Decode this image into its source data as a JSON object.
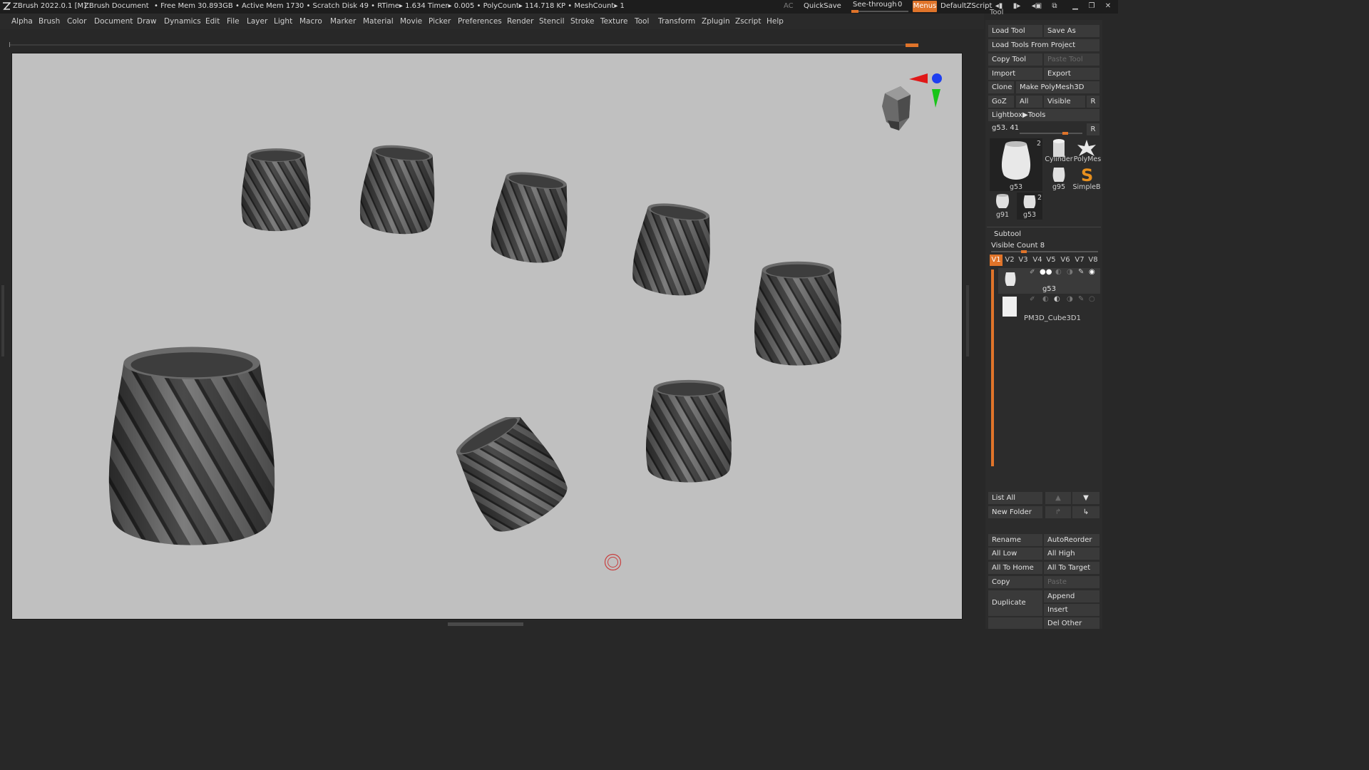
{
  "titlebar": {
    "app": "ZBrush 2022.0.1 [M]",
    "document": "ZBrush Document",
    "stats": "• Free Mem 30.893GB • Active Mem 1730 • Scratch Disk 49 •  RTime▸ 1.634 Timer▸ 0.005 • PolyCount▸ 114.718 KP  • MeshCount▸ 1",
    "ac": "AC",
    "quicksave": "QuickSave",
    "seethrough": "See-through",
    "seethrough_value": "0",
    "seethrough_level": 0,
    "menus": "Menus",
    "script": "DefaultZScript"
  },
  "menubar": [
    "Alpha",
    "Brush",
    "Color",
    "Document",
    "Draw",
    "Dynamics",
    "Edit",
    "File",
    "Layer",
    "Light",
    "Macro",
    "Marker",
    "Material",
    "Movie",
    "Picker",
    "Preferences",
    "Render",
    "Stencil",
    "Stroke",
    "Texture",
    "Tool",
    "Transform",
    "Zplugin",
    "Zscript",
    "Help"
  ],
  "tool": {
    "title": "Tool",
    "load_tool": "Load Tool",
    "save_as": "Save As",
    "load_from_project": "Load Tools From Project",
    "copy_tool": "Copy Tool",
    "paste_tool": "Paste Tool",
    "import": "Import",
    "export": "Export",
    "clone": "Clone",
    "make_polymesh": "Make PolyMesh3D",
    "goz": "GoZ",
    "all": "All",
    "visible": "Visible",
    "r": "R",
    "lightbox": "Lightbox▶Tools",
    "current": "g53. 41",
    "current_r": "R",
    "thumbs": {
      "main_label": "g53",
      "main_count": "2",
      "cylinder": "Cylinder",
      "polymesh": "PolyMes",
      "g95": "g95",
      "simpleb": "SimpleB",
      "g91": "g91",
      "g53b": "g53",
      "g53b_count": "2"
    }
  },
  "subtool": {
    "title": "Subtool",
    "visible_count": "Visible Count 8",
    "tabs": [
      "V1",
      "V2",
      "V3",
      "V4",
      "V5",
      "V6",
      "V7",
      "V8"
    ],
    "items": [
      {
        "name": "g53"
      },
      {
        "name": "PM3D_Cube3D1"
      }
    ],
    "list_all": "List All",
    "new_folder": "New Folder",
    "rename": "Rename",
    "auto_reorder": "AutoReorder",
    "all_low": "All Low",
    "all_high": "All High",
    "all_to_home": "All To Home",
    "all_to_target": "All To Target",
    "copy": "Copy",
    "paste": "Paste",
    "duplicate": "Duplicate",
    "append": "Append",
    "insert": "Insert",
    "del_other": "Del Other"
  },
  "colors": {
    "accent": "#e0742a",
    "viewport_bg": "#c0c0c0",
    "panel_bg": "#2c2c2c",
    "button_bg": "#3a3a3a"
  },
  "icons": [
    "zbrush-logo-icon",
    "navigation-cube-icon",
    "axis-gizmo-icon",
    "cursor-ring-icon",
    "eye-icon",
    "brush-icon",
    "arrow-up-icon",
    "arrow-down-icon"
  ]
}
